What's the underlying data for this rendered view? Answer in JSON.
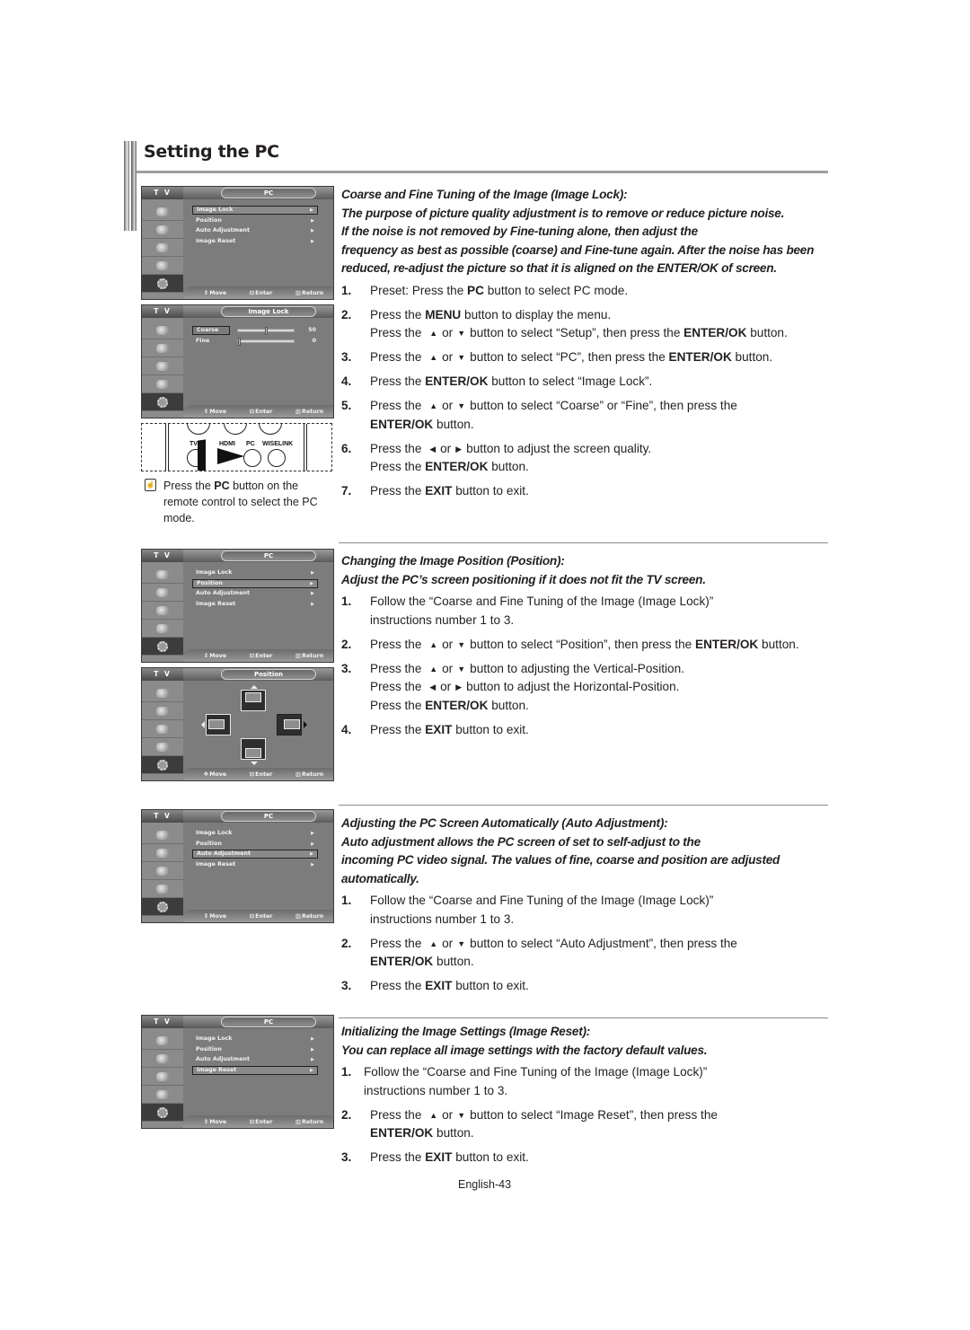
{
  "page": {
    "title": "Setting the PC",
    "footer": "English-43",
    "accent_rule_color": "#9e9e9e"
  },
  "osd_common": {
    "tv_label": "T V",
    "hint_move": "Move",
    "hint_enter": "Enter",
    "hint_return": "Return",
    "pc_menu_items": [
      "Image Lock",
      "Position",
      "Auto Adjustment",
      "Image Reset"
    ]
  },
  "osd_screens": [
    {
      "title": "PC",
      "selected": "Image Lock"
    },
    {
      "title": "Image Lock",
      "sliders": [
        {
          "label": "Coarse",
          "value": "50",
          "fraction": 0.5,
          "selected": true
        },
        {
          "label": "Fine",
          "value": "0",
          "fraction": 0.0,
          "selected": false
        }
      ]
    },
    {
      "title": "PC",
      "selected": "Position"
    },
    {
      "title": "Position"
    },
    {
      "title": "PC",
      "selected": "Auto Adjustment"
    },
    {
      "title": "PC",
      "selected": "Image Reset"
    }
  ],
  "remote": {
    "labels": [
      "TV",
      "HDMI",
      "PC",
      "WISELINK"
    ]
  },
  "note": {
    "icon": "hand-pointer-icon",
    "prefix": "Press the ",
    "bold": "PC",
    "suffix": " button on the remote control to select the PC mode."
  },
  "sections": [
    {
      "heading": "Coarse and Fine Tuning of the Image (Image Lock):",
      "intro_lines": [
        "The purpose of picture quality adjustment is to remove or reduce picture noise.",
        "If the noise is not removed by Fine-tuning alone, then adjust the",
        "frequency as best as possible (coarse) and Fine-tune again. After the noise has been",
        "reduced, re-adjust the picture so that it is aligned on the ENTER/OK of screen."
      ],
      "steps": [
        {
          "num": "1.",
          "lines": [
            [
              "Preset: Press the ",
              {
                "b": "PC"
              },
              " button to select PC mode."
            ]
          ]
        },
        {
          "num": "2.",
          "lines": [
            [
              "Press the ",
              {
                "b": "MENU"
              },
              " button to display the menu."
            ],
            [
              "Press the ",
              {
                "arrow": "up"
              },
              "or",
              {
                "arrow": "down"
              },
              "button to select “Setup”, then press the ",
              {
                "b": "ENTER/OK"
              },
              " button."
            ]
          ]
        },
        {
          "num": "3.",
          "lines": [
            [
              "Press the ",
              {
                "arrow": "up"
              },
              "or",
              {
                "arrow": "down"
              },
              "button to select “PC”, then press the ",
              {
                "b": "ENTER/OK"
              },
              " button."
            ]
          ]
        },
        {
          "num": "4.",
          "lines": [
            [
              "Press the ",
              {
                "b": "ENTER/OK"
              },
              " button to select “Image Lock”."
            ]
          ]
        },
        {
          "num": "5.",
          "lines": [
            [
              "Press the ",
              {
                "arrow": "up"
              },
              "or",
              {
                "arrow": "down"
              },
              "button to select “Coarse” or “Fine”,  then press the"
            ],
            [
              {
                "b": "ENTER/OK"
              },
              " button."
            ]
          ]
        },
        {
          "num": "6.",
          "lines": [
            [
              "Press the ",
              {
                "arrow": "left"
              },
              "or",
              {
                "arrow": "right"
              },
              "button to adjust the screen quality."
            ],
            [
              "Press the ",
              {
                "b": "ENTER/OK"
              },
              " button."
            ]
          ]
        },
        {
          "num": "7.",
          "lines": [
            [
              "Press the ",
              {
                "b": "EXIT"
              },
              " button to exit."
            ]
          ]
        }
      ]
    },
    {
      "heading": "Changing the Image Position (Position):",
      "intro_lines": [
        "Adjust the PC’s screen positioning if it does not fit the TV screen."
      ],
      "steps": [
        {
          "num": "1.",
          "lines": [
            [
              "Follow the “Coarse and Fine Tuning of the Image (Image Lock)”"
            ],
            [
              "instructions number 1 to 3."
            ]
          ]
        },
        {
          "num": "2.",
          "lines": [
            [
              "Press the ",
              {
                "arrow": "up"
              },
              "or",
              {
                "arrow": "down"
              },
              "button to select “Position”,  then press the ",
              {
                "b": "ENTER/OK"
              },
              " button."
            ]
          ]
        },
        {
          "num": "3.",
          "lines": [
            [
              "Press the ",
              {
                "arrow": "up"
              },
              "or",
              {
                "arrow": "down"
              },
              "button to adjusting the Vertical-Position."
            ],
            [
              "Press the ",
              {
                "arrow": "left"
              },
              "or",
              {
                "arrow": "right"
              },
              "button to adjust the Horizontal-Position."
            ],
            [
              "Press the ",
              {
                "b": "ENTER/OK"
              },
              " button."
            ]
          ]
        },
        {
          "num": "4.",
          "lines": [
            [
              "Press the ",
              {
                "b": "EXIT"
              },
              " button to exit."
            ]
          ]
        }
      ]
    },
    {
      "heading": "Adjusting the PC Screen Automatically (Auto Adjustment):",
      "intro_lines": [
        "Auto adjustment allows the PC screen of set to self-adjust to the",
        "incoming PC video signal. The values of fine, coarse and position are adjusted",
        "automatically."
      ],
      "steps": [
        {
          "num": "1.",
          "lines": [
            [
              "Follow the “Coarse and Fine Tuning of the Image (Image Lock)”"
            ],
            [
              "instructions number 1 to 3."
            ]
          ]
        },
        {
          "num": "2.",
          "lines": [
            [
              "Press the ",
              {
                "arrow": "up"
              },
              "or",
              {
                "arrow": "down"
              },
              "button to select “Auto Adjustment”,  then press the"
            ],
            [
              {
                "b": "ENTER/OK"
              },
              " button."
            ]
          ]
        },
        {
          "num": "3.",
          "lines": [
            [
              "Press the ",
              {
                "b": "EXIT"
              },
              " button to exit."
            ]
          ]
        }
      ]
    },
    {
      "heading": "Initializing the Image Settings (Image Reset):",
      "intro_lines": [
        "You can replace all image settings with the factory default values."
      ],
      "steps": [
        {
          "num": "1.",
          "tight": true,
          "lines": [
            [
              "Follow the “Coarse and Fine Tuning of the Image (Image Lock)”"
            ],
            [
              "instructions number 1 to 3."
            ]
          ]
        },
        {
          "num": "2.",
          "lines": [
            [
              "Press the ",
              {
                "arrow": "up"
              },
              "or",
              {
                "arrow": "down"
              },
              "button to select “Image Reset”,  then press the"
            ],
            [
              {
                "b": "ENTER/OK"
              },
              " button."
            ]
          ]
        },
        {
          "num": "3.",
          "lines": [
            [
              "Press the ",
              {
                "b": "EXIT"
              },
              " button to exit."
            ]
          ]
        }
      ]
    }
  ]
}
